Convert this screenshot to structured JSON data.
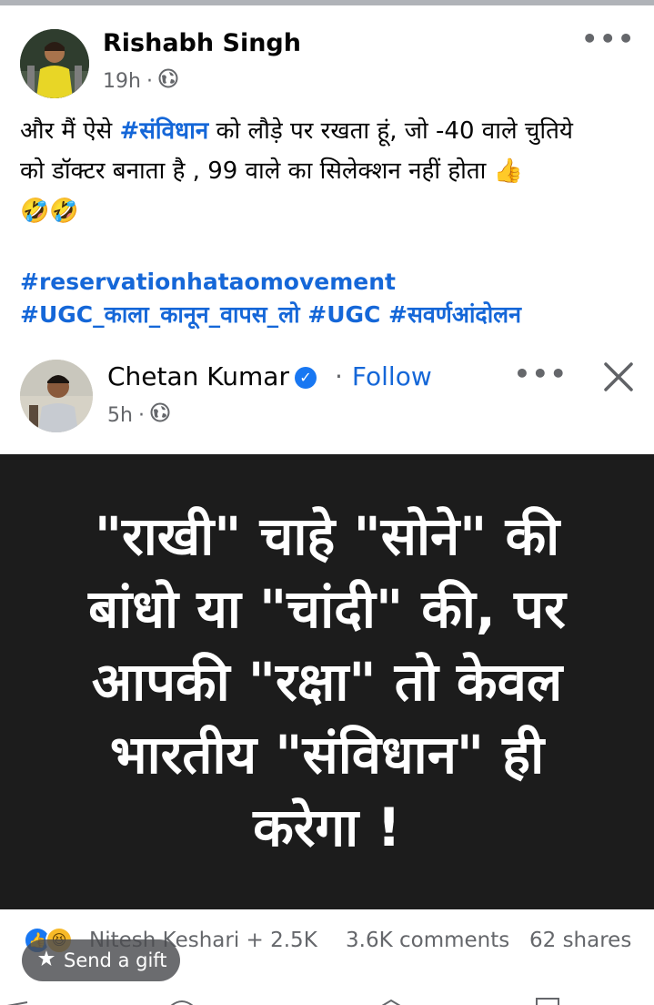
{
  "post": {
    "author": "Rishabh Singh",
    "time": "19h",
    "separator": "·",
    "text_line1_a": "और मैं ऐसे ",
    "text_line1_hashtag": "#संविधान",
    "text_line1_b": " को लौड़े पर रखता हूं, जो -40 वाले चुतिये",
    "text_line2": "को डॉक्टर बनाता है , 99 वाले का सिलेक्शन नहीं होता 👍",
    "text_line3": "🤣🤣",
    "hashtag_line1": "#reservationhataomovement",
    "hashtag_line2": "#UGC_काला_कानून_वापस_लो #UGC #सवर्णआंदोलन",
    "more_icon": "•••"
  },
  "shared": {
    "author": "Chetan Kumar",
    "verified_icon": "✓",
    "dot": "·",
    "follow_label": "Follow",
    "time": "5h",
    "separator": "·",
    "more_icon": "•••",
    "quote": "\"राखी\" चाहे \"सोने\" की बांधो या \"चांदी\" की, पर आपकी \"रक्षा\" तो केवल भारतीय \"संविधान\" ही करेगा !"
  },
  "reactions": {
    "like_icon": "👍",
    "haha_icon": "😆",
    "reactors_text": "Nitesh Keshari + 2.5K",
    "comments_text": "3.6K comments",
    "shares_text": "62 shares"
  },
  "gift": {
    "label": "Send a gift"
  }
}
